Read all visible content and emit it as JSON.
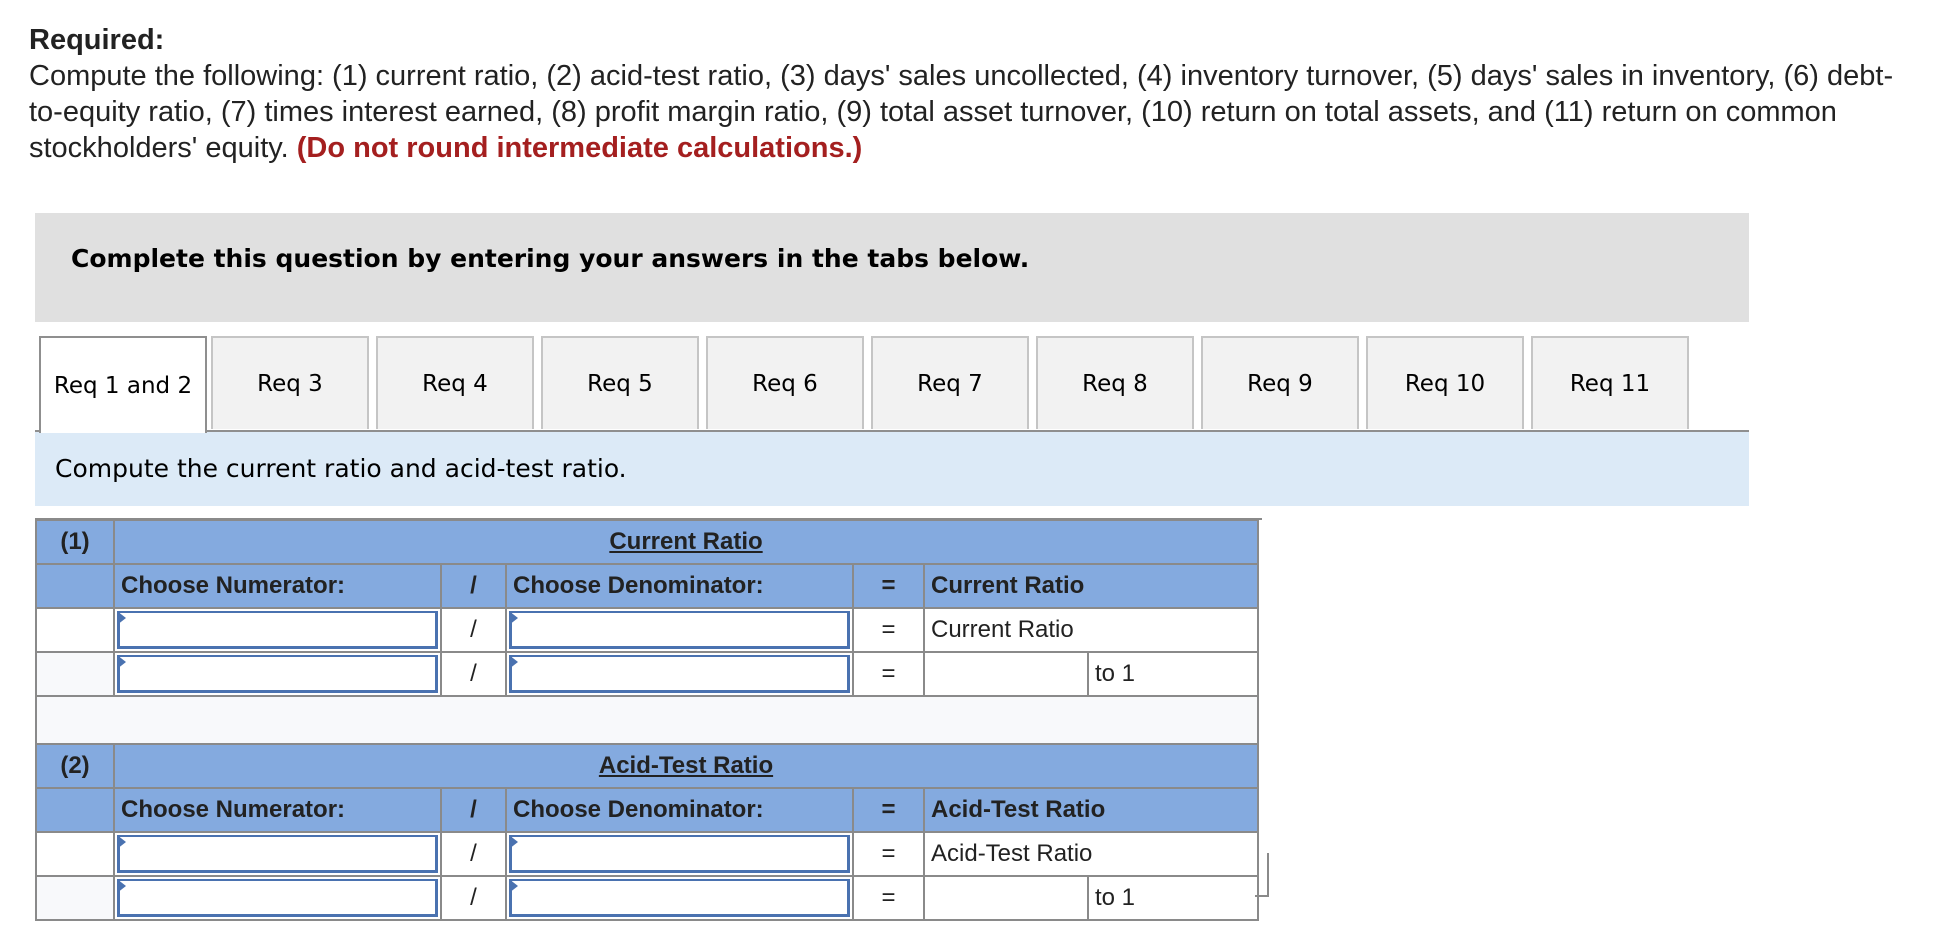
{
  "required": {
    "title": "Required:",
    "body": "Compute the following: (1) current ratio, (2) acid-test ratio, (3) days' sales uncollected, (4) inventory turnover, (5) days' sales in inventory, (6) debt-to-equity ratio, (7) times interest earned, (8) profit margin ratio, (9) total asset turnover, (10) return on total assets, and (11) return on common stockholders' equity.",
    "warning": "(Do not round intermediate calculations.)"
  },
  "banner": {
    "message": "Complete this question by entering your answers in the tabs below."
  },
  "tabs": [
    {
      "label": "Req 1 and 2",
      "active": true
    },
    {
      "label": "Req 3",
      "active": false
    },
    {
      "label": "Req 4",
      "active": false
    },
    {
      "label": "Req 5",
      "active": false
    },
    {
      "label": "Req 6",
      "active": false
    },
    {
      "label": "Req 7",
      "active": false
    },
    {
      "label": "Req 8",
      "active": false
    },
    {
      "label": "Req 9",
      "active": false
    },
    {
      "label": "Req 10",
      "active": false
    },
    {
      "label": "Req 11",
      "active": false
    }
  ],
  "instruction": "Compute the current ratio and acid-test ratio.",
  "sections": [
    {
      "number": "(1)",
      "title": "Current Ratio",
      "numerator_header": "Choose Numerator:",
      "divide": "/",
      "denominator_header": "Choose Denominator:",
      "equals": "=",
      "result_header": "Current Ratio",
      "row1": {
        "numerator": "",
        "denominator": "",
        "result_label": "Current Ratio"
      },
      "row2": {
        "numerator": "",
        "denominator": "",
        "result_value": "",
        "suffix": "to 1"
      }
    },
    {
      "number": "(2)",
      "title": "Acid-Test Ratio",
      "numerator_header": "Choose Numerator:",
      "divide": "/",
      "denominator_header": "Choose Denominator:",
      "equals": "=",
      "result_header": "Acid-Test Ratio",
      "row1": {
        "numerator": "",
        "denominator": "",
        "result_label": "Acid-Test Ratio"
      },
      "row2": {
        "numerator": "",
        "denominator": "",
        "result_value": "",
        "suffix": "to 1"
      }
    }
  ]
}
